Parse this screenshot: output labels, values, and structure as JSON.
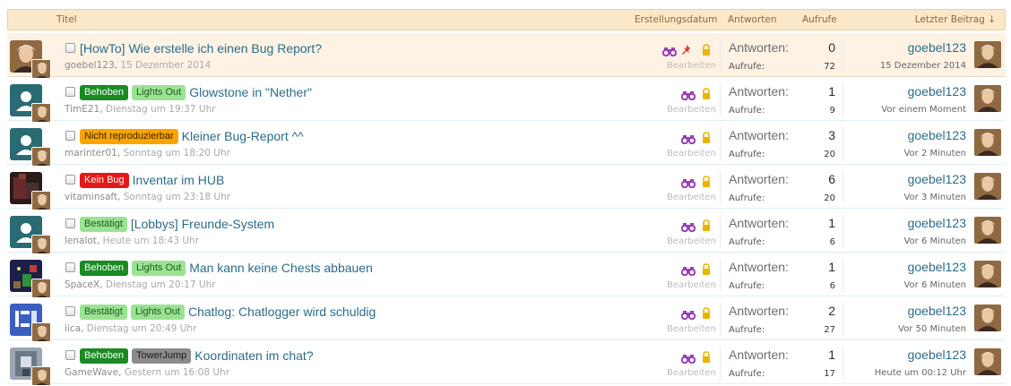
{
  "header": {
    "title": "Titel",
    "created": "Erstellungsdatum",
    "answers": "Antworten",
    "views": "Aufrufe",
    "last_post": "Letzter Beitrag ↓"
  },
  "labels": {
    "answers": "Antworten:",
    "views": "Aufrufe:",
    "edit": "Bearbeiten"
  },
  "colors": {
    "header_bg": "#fbe8c8",
    "link": "#2b6c8a",
    "sticky_bg": "#fdf2e4",
    "binoculars": "#9b3fb8",
    "lock": "#e9b500",
    "pin": "#d33b3b"
  },
  "threads": [
    {
      "sticky": true,
      "prefixes": [],
      "title": "[HowTo] Wie erstelle ich einen Bug Report?",
      "author": "goebel123",
      "date": "15 Dezember 2014",
      "pinned": true,
      "answers": "0",
      "views": "72",
      "last_user": "goebel123",
      "last_date": "15 Dezember 2014",
      "avatar": "photo"
    },
    {
      "sticky": false,
      "prefixes": [
        {
          "label": "Behoben",
          "cls": "p-behoben"
        },
        {
          "label": "Lights Out",
          "cls": "p-lights"
        }
      ],
      "title": "Glowstone in \"Nether\"",
      "author": "TimE21",
      "date": "Dienstag um 19:37 Uhr",
      "pinned": false,
      "answers": "1",
      "views": "9",
      "last_user": "goebel123",
      "last_date": "Vor einem Moment",
      "avatar": "default"
    },
    {
      "sticky": false,
      "prefixes": [
        {
          "label": "Nicht reproduzierbar",
          "cls": "p-nicht"
        }
      ],
      "title": "Kleiner Bug-Report ^^",
      "author": "marinter01",
      "date": "Sonntag um 18:20 Uhr",
      "pinned": false,
      "answers": "3",
      "views": "20",
      "last_user": "goebel123",
      "last_date": "Vor 2 Minuten",
      "avatar": "default"
    },
    {
      "sticky": false,
      "prefixes": [
        {
          "label": "Kein Bug",
          "cls": "p-kein"
        }
      ],
      "title": "Inventar im HUB",
      "author": "vitaminsaft",
      "date": "Sonntag um 23:18 Uhr",
      "pinned": false,
      "answers": "6",
      "views": "20",
      "last_user": "goebel123",
      "last_date": "Vor 3 Minuten",
      "avatar": "dark"
    },
    {
      "sticky": false,
      "prefixes": [
        {
          "label": "Bestätigt",
          "cls": "p-bestaetigt"
        }
      ],
      "title": "[Lobbys] Freunde-System",
      "author": "lenalot",
      "date": "Heute um 18:43 Uhr",
      "pinned": false,
      "answers": "1",
      "views": "6",
      "last_user": "goebel123",
      "last_date": "Vor 6 Minuten",
      "avatar": "default"
    },
    {
      "sticky": false,
      "prefixes": [
        {
          "label": "Behoben",
          "cls": "p-behoben"
        },
        {
          "label": "Lights Out",
          "cls": "p-lights"
        }
      ],
      "title": "Man kann keine Chests abbauen",
      "author": "SpaceX",
      "date": "Dienstag um 20:17 Uhr",
      "pinned": false,
      "answers": "1",
      "views": "6",
      "last_user": "goebel123",
      "last_date": "Vor 6 Minuten",
      "avatar": "space"
    },
    {
      "sticky": false,
      "prefixes": [
        {
          "label": "Bestätigt",
          "cls": "p-bestaetigt"
        },
        {
          "label": "Lights Out",
          "cls": "p-lights"
        }
      ],
      "title": "Chatlog: Chatlogger wird schuldig",
      "author": "iica",
      "date": "Dienstag um 20:49 Uhr",
      "pinned": false,
      "answers": "2",
      "views": "27",
      "last_user": "goebel123",
      "last_date": "Vor 50 Minuten",
      "avatar": "blue"
    },
    {
      "sticky": false,
      "prefixes": [
        {
          "label": "Behoben",
          "cls": "p-behoben"
        },
        {
          "label": "TowerJump",
          "cls": "p-tower"
        }
      ],
      "title": "Koordinaten im chat?",
      "author": "GameWave",
      "date": "Gestern um 16:08 Uhr",
      "pinned": false,
      "answers": "1",
      "views": "17",
      "last_user": "goebel123",
      "last_date": "Heute um 00:12 Uhr",
      "avatar": "grey"
    }
  ]
}
